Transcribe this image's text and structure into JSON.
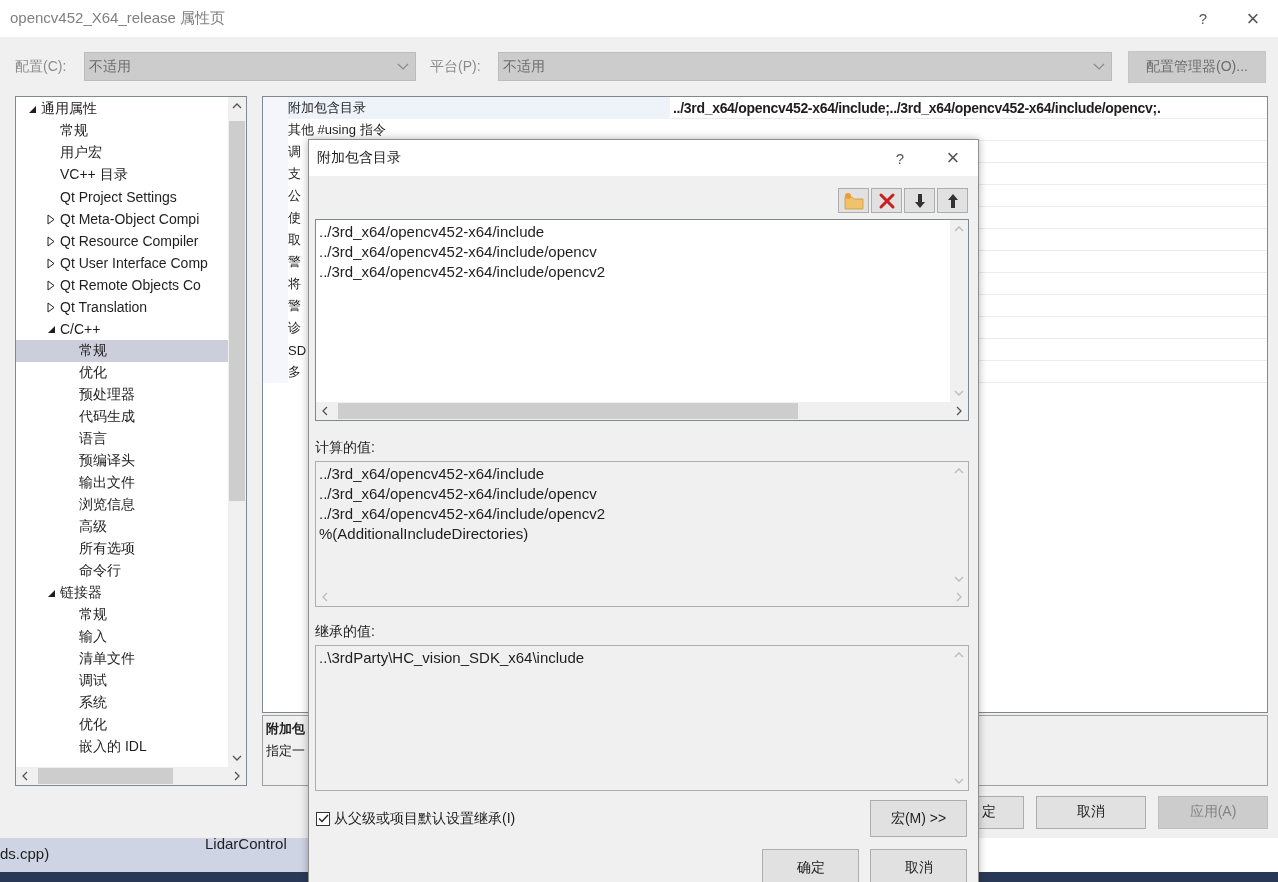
{
  "window": {
    "title": "opencv452_X64_release 属性页",
    "help": "?",
    "close": "×"
  },
  "config_bar": {
    "configuration_label": "配置(C):",
    "configuration": {
      "value": "不适用",
      "disabled": true
    },
    "platform_label": "平台(P):",
    "platform": {
      "value": "不适用",
      "disabled": true
    },
    "manager_button": "配置管理器(O)..."
  },
  "tree": [
    {
      "label": "通用属性",
      "expanded": true,
      "selected": false,
      "children": [
        {
          "label": "常规",
          "selected": false
        },
        {
          "label": "用户宏",
          "selected": false
        },
        {
          "label": "VC++ 目录",
          "selected": false
        },
        {
          "label": "Qt Project Settings",
          "selected": false
        },
        {
          "label": "Qt Meta-Object Compi",
          "expanded": false,
          "selected": false
        },
        {
          "label": "Qt Resource Compiler",
          "expanded": false,
          "selected": false
        },
        {
          "label": "Qt User Interface Comp",
          "expanded": false,
          "selected": false
        },
        {
          "label": "Qt Remote Objects Co",
          "expanded": false,
          "selected": false
        },
        {
          "label": "Qt Translation",
          "expanded": false,
          "selected": false
        },
        {
          "label": "C/C++",
          "expanded": true,
          "selected": false,
          "children": [
            {
              "label": "常规",
              "selected": true
            },
            {
              "label": "优化",
              "selected": false
            },
            {
              "label": "预处理器",
              "selected": false
            },
            {
              "label": "代码生成",
              "selected": false
            },
            {
              "label": "语言",
              "selected": false
            },
            {
              "label": "预编译头",
              "selected": false
            },
            {
              "label": "输出文件",
              "selected": false
            },
            {
              "label": "浏览信息",
              "selected": false
            },
            {
              "label": "高级",
              "selected": false
            },
            {
              "label": "所有选项",
              "selected": false
            },
            {
              "label": "命令行",
              "selected": false
            }
          ]
        },
        {
          "label": "链接器",
          "expanded": true,
          "selected": false,
          "children": [
            {
              "label": "常规",
              "selected": false
            },
            {
              "label": "输入",
              "selected": false
            },
            {
              "label": "清单文件",
              "selected": false
            },
            {
              "label": "调试",
              "selected": false
            },
            {
              "label": "系统",
              "selected": false
            },
            {
              "label": "优化",
              "selected": false
            },
            {
              "label": "嵌入的 IDL",
              "selected": false
            }
          ]
        }
      ]
    }
  ],
  "property_grid": {
    "rows": [
      {
        "label": "附加包含目录",
        "value": "../3rd_x64/opencv452-x64/include;../3rd_x64/opencv452-x64/include/opencv;.",
        "selected": true
      },
      {
        "label": "其他 #using 指令",
        "selected": false
      },
      {
        "label": "调",
        "selected": false
      },
      {
        "label": "支",
        "selected": false
      },
      {
        "label": "公",
        "selected": false
      },
      {
        "label": "使",
        "selected": false
      },
      {
        "label": "取",
        "selected": false
      },
      {
        "label": "警",
        "selected": false
      },
      {
        "label": "将",
        "selected": false
      },
      {
        "label": "警",
        "selected": false
      },
      {
        "label": "诊",
        "selected": false
      },
      {
        "label": "SD",
        "selected": false
      },
      {
        "label": "多",
        "selected": false
      }
    ]
  },
  "description": {
    "title": "附加包",
    "text": "指定一"
  },
  "buttons": [
    {
      "label": "定",
      "disabled": false
    },
    {
      "label": "取消",
      "disabled": false
    },
    {
      "label": "应用(A)",
      "disabled": true
    }
  ],
  "background": {
    "file": "ds.cpp)",
    "project": "LidarControl"
  },
  "dialog": {
    "title": "附加包含目录",
    "help": "?",
    "close": "×",
    "entries": [
      "../3rd_x64/opencv452-x64/include",
      "../3rd_x64/opencv452-x64/include/opencv",
      "../3rd_x64/opencv452-x64/include/opencv2"
    ],
    "computed_label": "计算的值:",
    "computed": [
      "../3rd_x64/opencv452-x64/include",
      "../3rd_x64/opencv452-x64/include/opencv",
      "../3rd_x64/opencv452-x64/include/opencv2",
      "%(AdditionalIncludeDirectories)"
    ],
    "inherited_label": "继承的值:",
    "inherited": [
      "..\\3rdParty\\HC_vision_SDK_x64\\include"
    ],
    "inherit_checkbox": {
      "label": "从父级或项目默认设置继承(I)",
      "checked": true
    },
    "macro_button": "宏(M) >>",
    "ok": "确定",
    "cancel": "取消"
  }
}
